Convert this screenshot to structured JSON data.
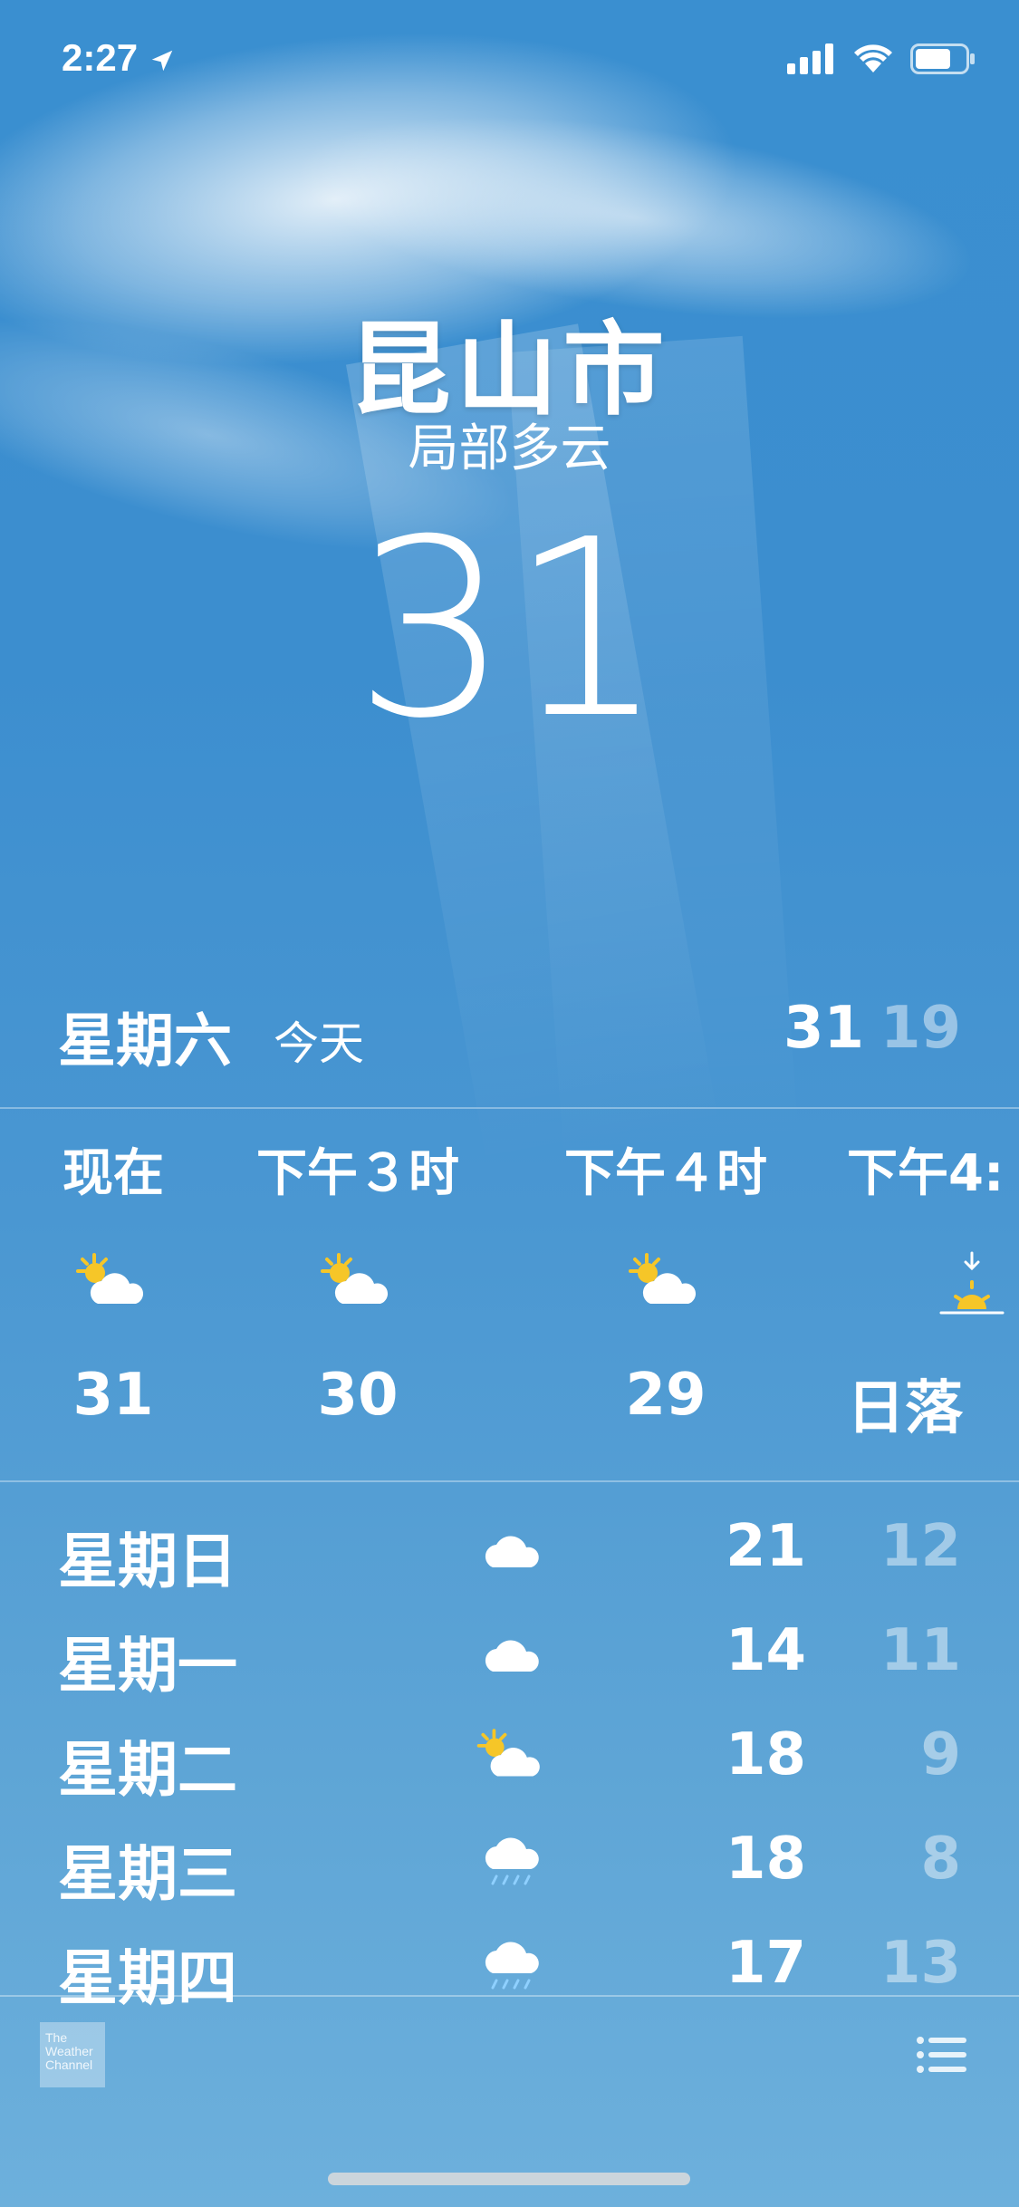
{
  "status_bar": {
    "time": "2:27"
  },
  "header": {
    "city": "昆山市",
    "condition": "局部多云",
    "temperature": "31"
  },
  "today": {
    "day": "星期六",
    "tag": "今天",
    "high": "31",
    "low": "19"
  },
  "hourly": [
    {
      "label": "现在",
      "icon": "partly-cloudy-icon",
      "value": "31"
    },
    {
      "label": "下午３时",
      "icon": "partly-cloudy-icon",
      "value": "30"
    },
    {
      "label": "下午４时",
      "icon": "partly-cloudy-icon",
      "value": "29"
    },
    {
      "label": "下午4:",
      "icon": "sunset-icon",
      "value": "日落"
    }
  ],
  "daily": [
    {
      "day": "星期日",
      "icon": "cloud-icon",
      "high": "21",
      "low": "12"
    },
    {
      "day": "星期一",
      "icon": "cloud-icon",
      "high": "14",
      "low": "11"
    },
    {
      "day": "星期二",
      "icon": "partly-cloudy-icon",
      "high": "18",
      "low": "9"
    },
    {
      "day": "星期三",
      "icon": "rain-icon",
      "high": "18",
      "low": "8"
    },
    {
      "day": "星期四",
      "icon": "rain-icon",
      "high": "17",
      "low": "13"
    }
  ],
  "footer": {
    "logo_text": "The Weather Channel"
  },
  "colors": {
    "sun": "#f6c628",
    "rain": "#8fd0ff",
    "low_text": "rgba(255,255,255,0.45)"
  }
}
